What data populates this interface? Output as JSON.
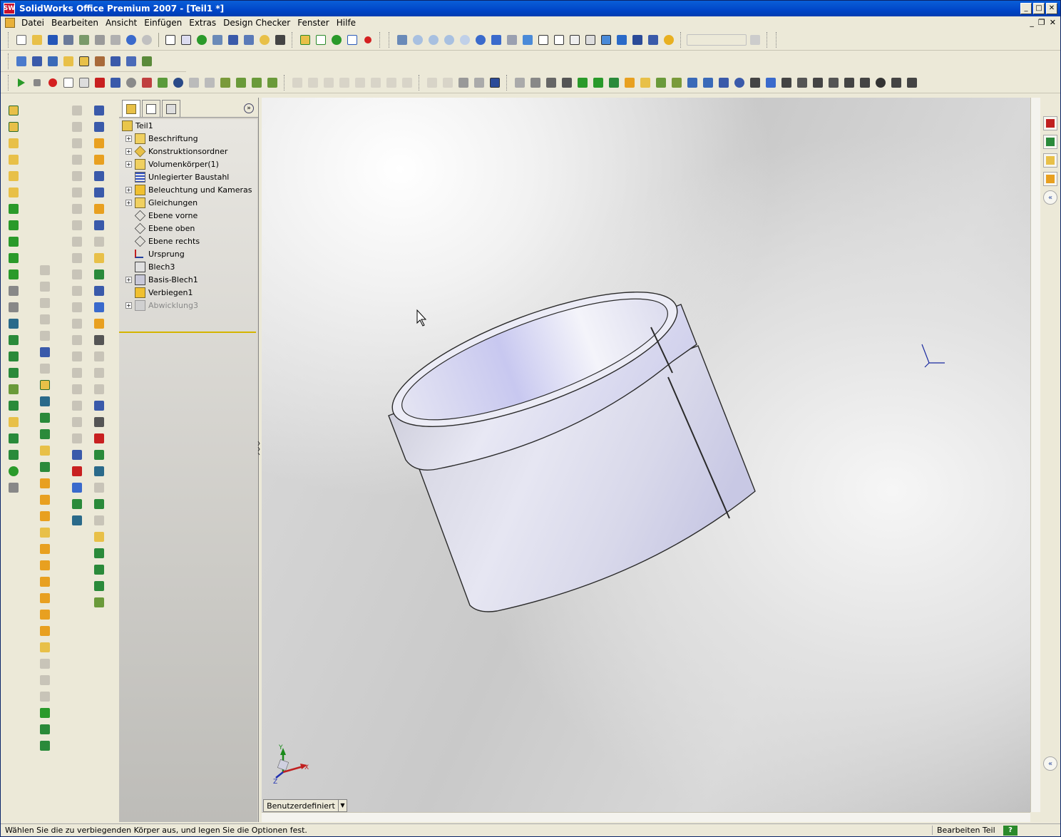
{
  "window": {
    "title": "SolidWorks Office Premium 2007 - [Teil1 *]",
    "app_icon_text": "SW"
  },
  "menu": {
    "items": [
      "Datei",
      "Bearbeiten",
      "Ansicht",
      "Einfügen",
      "Extras",
      "Design Checker",
      "Fenster",
      "Hilfe"
    ]
  },
  "feature_tree": {
    "root": "Teil1",
    "items": [
      {
        "label": "Beschriftung",
        "expandable": true,
        "icon": "annotation-icon"
      },
      {
        "label": "Konstruktionsordner",
        "expandable": true,
        "icon": "design-folder-icon"
      },
      {
        "label": "Volumenkörper(1)",
        "expandable": true,
        "icon": "solid-bodies-icon"
      },
      {
        "label": "Unlegierter Baustahl",
        "expandable": false,
        "icon": "material-icon"
      },
      {
        "label": "Beleuchtung und Kameras",
        "expandable": true,
        "icon": "lights-cameras-icon"
      },
      {
        "label": "Gleichungen",
        "expandable": true,
        "icon": "equations-icon"
      },
      {
        "label": "Ebene vorne",
        "expandable": false,
        "icon": "plane-icon"
      },
      {
        "label": "Ebene oben",
        "expandable": false,
        "icon": "plane-icon"
      },
      {
        "label": "Ebene rechts",
        "expandable": false,
        "icon": "plane-icon"
      },
      {
        "label": "Ursprung",
        "expandable": false,
        "icon": "origin-icon"
      },
      {
        "label": "Blech3",
        "expandable": false,
        "icon": "sheet-metal-icon"
      },
      {
        "label": "Basis-Blech1",
        "expandable": true,
        "icon": "base-flange-icon"
      },
      {
        "label": "Verbiegen1",
        "expandable": false,
        "icon": "unfold-icon"
      },
      {
        "label": "Abwicklung3",
        "expandable": true,
        "icon": "flat-pattern-icon",
        "suppressed": true
      }
    ]
  },
  "viewport": {
    "view_config": "Benutzerdefiniert",
    "triad": {
      "x": "X",
      "y": "Y",
      "z": "Z"
    }
  },
  "statusbar": {
    "message": "Wählen Sie die zu verbiegenden Körper aus, und legen Sie die Optionen fest.",
    "mode": "Bearbeiten Teil",
    "help": "?"
  },
  "colors": {
    "titlebar": "#0046c8",
    "toolbar": "#ece9d8",
    "model_face": "#d8d8ea",
    "model_highlight": "#c4c4ee",
    "rollback_bar": "#d4b400"
  }
}
